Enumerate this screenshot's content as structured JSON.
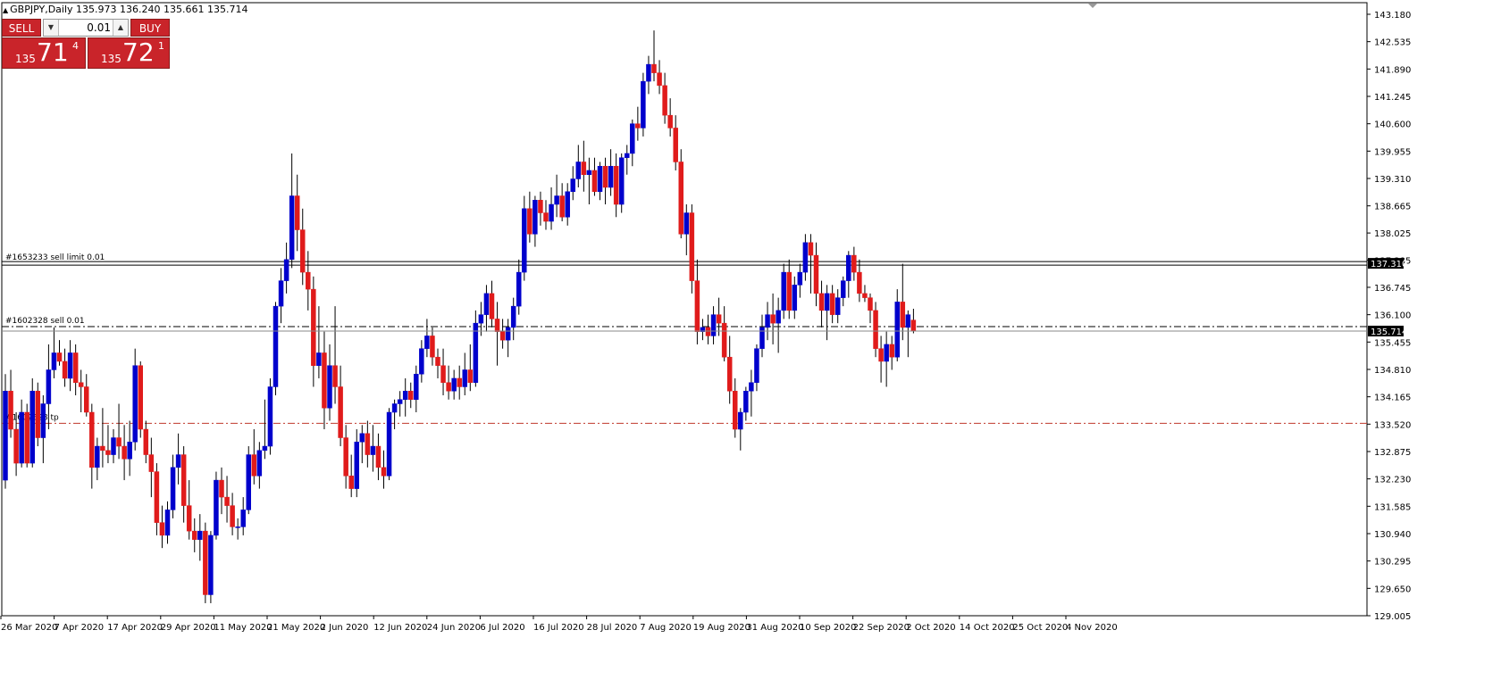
{
  "header": {
    "symbol_line": "GBPJPY,Daily  135.973 136.240 135.661 135.714"
  },
  "trade_panel": {
    "sell_label": "SELL",
    "buy_label": "BUY",
    "lot_value": "0.01",
    "sell_price_small": "135",
    "sell_price_big": "71",
    "sell_price_sup": "4",
    "buy_price_small": "135",
    "buy_price_big": "72",
    "buy_price_sup": "1"
  },
  "price_axis": {
    "labels": [
      "143.180",
      "142.535",
      "141.890",
      "141.245",
      "140.600",
      "139.955",
      "139.310",
      "138.665",
      "138.025",
      "137.385",
      "136.745",
      "136.100",
      "135.455",
      "134.810",
      "134.165",
      "133.520",
      "132.875",
      "132.230",
      "131.585",
      "130.940",
      "130.295",
      "129.650",
      "129.005"
    ],
    "current_price_tag": "135.714",
    "order_price_tag": "137.310"
  },
  "time_axis": {
    "labels": [
      "26 Mar 2020",
      "7 Apr 2020",
      "17 Apr 2020",
      "29 Apr 2020",
      "11 May 2020",
      "21 May 2020",
      "2 Jun 2020",
      "12 Jun 2020",
      "24 Jun 2020",
      "6 Jul 2020",
      "16 Jul 2020",
      "28 Jul 2020",
      "7 Aug 2020",
      "19 Aug 2020",
      "31 Aug 2020",
      "10 Sep 2020",
      "22 Sep 2020",
      "2 Oct 2020",
      "14 Oct 2020",
      "25 Oct 2020",
      "4 Nov 2020"
    ]
  },
  "order_lines": [
    {
      "label": "#1653233 sell limit 0.01",
      "price": 137.31,
      "style": "solid"
    },
    {
      "label": "#1602328 sell 0.01",
      "price": 135.82,
      "style": "dashdot"
    },
    {
      "label": "#1602328 tp",
      "price": 133.54,
      "style": "dashdot-red"
    }
  ],
  "colors": {
    "bull": "#0000cc",
    "bear": "#e01b1b",
    "wick": "#000000",
    "background": "#ffffff",
    "tp_line": "#c0392b"
  },
  "chart_data": {
    "type": "candlestick",
    "symbol": "GBPJPY",
    "timeframe": "Daily",
    "ylim": [
      129.005,
      143.18
    ],
    "candles": [
      [
        132.2,
        134.7,
        132.0,
        134.3
      ],
      [
        134.3,
        134.8,
        133.2,
        133.4
      ],
      [
        133.4,
        133.8,
        132.3,
        132.6
      ],
      [
        132.6,
        134.1,
        132.5,
        133.8
      ],
      [
        133.8,
        134.0,
        132.5,
        132.6
      ],
      [
        132.6,
        134.6,
        132.5,
        134.3
      ],
      [
        134.3,
        134.5,
        133.0,
        133.2
      ],
      [
        133.2,
        134.2,
        132.6,
        134.0
      ],
      [
        134.0,
        135.4,
        133.4,
        134.8
      ],
      [
        134.8,
        135.8,
        134.6,
        135.2
      ],
      [
        135.2,
        135.5,
        134.9,
        135.0
      ],
      [
        135.0,
        135.3,
        134.4,
        134.6
      ],
      [
        134.6,
        135.5,
        134.3,
        135.2
      ],
      [
        135.2,
        135.4,
        134.2,
        134.5
      ],
      [
        134.5,
        134.8,
        133.8,
        134.4
      ],
      [
        134.4,
        134.7,
        133.7,
        133.8
      ],
      [
        133.8,
        134.0,
        132.0,
        132.5
      ],
      [
        132.5,
        133.2,
        132.2,
        133.0
      ],
      [
        133.0,
        133.9,
        132.5,
        132.9
      ],
      [
        132.9,
        133.5,
        132.6,
        132.8
      ],
      [
        132.8,
        133.4,
        132.6,
        133.2
      ],
      [
        133.2,
        134.0,
        132.7,
        133.0
      ],
      [
        133.0,
        133.5,
        132.2,
        132.7
      ],
      [
        132.7,
        133.6,
        132.3,
        133.1
      ],
      [
        133.1,
        135.3,
        132.9,
        134.9
      ],
      [
        134.9,
        135.0,
        133.2,
        133.4
      ],
      [
        133.4,
        133.6,
        132.6,
        132.8
      ],
      [
        132.8,
        133.2,
        131.8,
        132.4
      ],
      [
        132.4,
        132.6,
        130.9,
        131.2
      ],
      [
        131.2,
        131.6,
        130.6,
        130.9
      ],
      [
        130.9,
        131.7,
        130.7,
        131.5
      ],
      [
        131.5,
        132.8,
        131.3,
        132.5
      ],
      [
        132.5,
        133.3,
        132.1,
        132.8
      ],
      [
        132.8,
        133.0,
        131.2,
        131.6
      ],
      [
        131.6,
        132.2,
        130.8,
        131.0
      ],
      [
        131.0,
        131.3,
        130.5,
        130.8
      ],
      [
        130.8,
        131.4,
        130.3,
        131.0
      ],
      [
        131.0,
        131.2,
        129.3,
        129.5
      ],
      [
        129.5,
        131.0,
        129.3,
        130.9
      ],
      [
        130.9,
        132.4,
        130.8,
        132.2
      ],
      [
        132.2,
        132.5,
        131.4,
        131.8
      ],
      [
        131.8,
        132.3,
        131.2,
        131.6
      ],
      [
        131.6,
        131.9,
        130.9,
        131.1
      ],
      [
        131.1,
        131.3,
        130.8,
        131.1
      ],
      [
        131.1,
        131.8,
        130.9,
        131.5
      ],
      [
        131.5,
        133.0,
        131.4,
        132.8
      ],
      [
        132.8,
        133.4,
        132.1,
        132.3
      ],
      [
        132.3,
        133.1,
        132.0,
        132.9
      ],
      [
        132.9,
        134.1,
        132.7,
        133.0
      ],
      [
        133.0,
        134.6,
        132.8,
        134.4
      ],
      [
        134.4,
        136.4,
        134.2,
        136.3
      ],
      [
        136.3,
        137.2,
        135.9,
        136.9
      ],
      [
        136.9,
        137.8,
        136.6,
        137.4
      ],
      [
        137.4,
        139.9,
        137.2,
        138.9
      ],
      [
        138.9,
        139.4,
        137.6,
        138.1
      ],
      [
        138.1,
        138.6,
        136.8,
        137.1
      ],
      [
        137.1,
        137.6,
        136.2,
        136.7
      ],
      [
        136.7,
        137.0,
        134.4,
        134.9
      ],
      [
        134.9,
        136.3,
        134.6,
        135.2
      ],
      [
        135.2,
        135.7,
        133.4,
        133.9
      ],
      [
        133.9,
        135.4,
        133.6,
        134.9
      ],
      [
        134.9,
        136.3,
        134.0,
        134.4
      ],
      [
        134.4,
        134.9,
        133.0,
        133.2
      ],
      [
        133.2,
        133.5,
        132.0,
        132.3
      ],
      [
        132.3,
        132.8,
        131.8,
        132.0
      ],
      [
        132.0,
        133.4,
        131.8,
        133.1
      ],
      [
        133.1,
        133.5,
        132.6,
        133.3
      ],
      [
        133.3,
        133.6,
        132.5,
        132.8
      ],
      [
        132.8,
        133.5,
        132.4,
        133.0
      ],
      [
        133.0,
        133.3,
        132.2,
        132.5
      ],
      [
        132.5,
        132.9,
        132.0,
        132.3
      ],
      [
        132.3,
        133.9,
        132.2,
        133.8
      ],
      [
        133.8,
        134.1,
        133.4,
        134.0
      ],
      [
        134.0,
        134.3,
        133.7,
        134.1
      ],
      [
        134.1,
        134.6,
        133.7,
        134.3
      ],
      [
        134.3,
        134.5,
        133.9,
        134.1
      ],
      [
        134.1,
        134.9,
        133.8,
        134.7
      ],
      [
        134.7,
        135.5,
        134.5,
        135.3
      ],
      [
        135.3,
        136.0,
        135.1,
        135.6
      ],
      [
        135.6,
        135.8,
        134.9,
        135.1
      ],
      [
        135.1,
        135.3,
        134.6,
        134.9
      ],
      [
        134.9,
        135.3,
        134.2,
        134.5
      ],
      [
        134.5,
        134.9,
        134.1,
        134.3
      ],
      [
        134.3,
        134.8,
        134.1,
        134.6
      ],
      [
        134.6,
        134.9,
        134.1,
        134.4
      ],
      [
        134.4,
        135.2,
        134.2,
        134.8
      ],
      [
        134.8,
        135.4,
        134.3,
        134.5
      ],
      [
        134.5,
        136.2,
        134.4,
        135.9
      ],
      [
        135.9,
        136.4,
        135.6,
        136.1
      ],
      [
        136.1,
        136.8,
        135.7,
        136.6
      ],
      [
        136.6,
        136.9,
        135.8,
        136.0
      ],
      [
        136.0,
        136.4,
        134.9,
        135.7
      ],
      [
        135.7,
        136.0,
        135.3,
        135.5
      ],
      [
        135.5,
        136.0,
        135.1,
        135.8
      ],
      [
        135.8,
        136.5,
        135.5,
        136.3
      ],
      [
        136.3,
        137.4,
        136.1,
        137.1
      ],
      [
        137.1,
        138.9,
        136.9,
        138.6
      ],
      [
        138.6,
        139.0,
        137.8,
        138.0
      ],
      [
        138.0,
        138.9,
        137.7,
        138.8
      ],
      [
        138.8,
        139.0,
        138.2,
        138.5
      ],
      [
        138.5,
        138.8,
        138.1,
        138.3
      ],
      [
        138.3,
        139.1,
        138.1,
        138.7
      ],
      [
        138.7,
        139.4,
        138.4,
        138.9
      ],
      [
        138.9,
        139.2,
        138.3,
        138.4
      ],
      [
        138.4,
        139.2,
        138.2,
        139.0
      ],
      [
        139.0,
        139.6,
        138.8,
        139.3
      ],
      [
        139.3,
        140.1,
        139.1,
        139.7
      ],
      [
        139.7,
        140.2,
        139.0,
        139.4
      ],
      [
        139.4,
        139.8,
        138.7,
        139.5
      ],
      [
        139.5,
        139.8,
        138.9,
        139.0
      ],
      [
        139.0,
        139.7,
        138.8,
        139.6
      ],
      [
        139.6,
        139.8,
        138.7,
        139.1
      ],
      [
        139.1,
        140.0,
        138.9,
        139.6
      ],
      [
        139.6,
        139.9,
        138.4,
        138.7
      ],
      [
        138.7,
        139.9,
        138.5,
        139.8
      ],
      [
        139.8,
        140.1,
        139.4,
        139.9
      ],
      [
        139.9,
        140.7,
        139.6,
        140.6
      ],
      [
        140.6,
        141.0,
        140.2,
        140.5
      ],
      [
        140.5,
        141.8,
        140.3,
        141.6
      ],
      [
        141.6,
        142.2,
        141.3,
        142.0
      ],
      [
        142.0,
        142.8,
        141.6,
        141.8
      ],
      [
        141.8,
        142.1,
        141.3,
        141.5
      ],
      [
        141.5,
        141.8,
        140.6,
        140.8
      ],
      [
        140.8,
        141.2,
        140.3,
        140.5
      ],
      [
        140.5,
        140.8,
        139.5,
        139.7
      ],
      [
        139.7,
        140.0,
        137.9,
        138.0
      ],
      [
        138.0,
        138.7,
        137.5,
        138.5
      ],
      [
        138.5,
        138.7,
        136.6,
        136.9
      ],
      [
        136.9,
        137.4,
        135.4,
        135.7
      ],
      [
        135.7,
        136.0,
        135.5,
        135.8
      ],
      [
        135.8,
        136.1,
        135.4,
        135.6
      ],
      [
        135.6,
        136.3,
        135.4,
        136.1
      ],
      [
        136.1,
        136.5,
        135.6,
        135.9
      ],
      [
        135.9,
        136.3,
        135.0,
        135.1
      ],
      [
        135.1,
        135.6,
        134.0,
        134.3
      ],
      [
        134.3,
        134.6,
        133.2,
        133.4
      ],
      [
        133.4,
        133.9,
        132.9,
        133.8
      ],
      [
        133.8,
        134.4,
        133.6,
        134.3
      ],
      [
        134.3,
        134.8,
        133.7,
        134.5
      ],
      [
        134.5,
        135.4,
        134.3,
        135.3
      ],
      [
        135.3,
        136.1,
        135.1,
        135.8
      ],
      [
        135.8,
        136.4,
        135.5,
        136.1
      ],
      [
        136.1,
        136.6,
        135.4,
        135.9
      ],
      [
        135.9,
        136.5,
        135.2,
        136.2
      ],
      [
        136.2,
        137.3,
        136.0,
        137.1
      ],
      [
        137.1,
        137.4,
        136.0,
        136.2
      ],
      [
        136.2,
        137.0,
        136.0,
        136.8
      ],
      [
        136.8,
        137.3,
        136.5,
        137.1
      ],
      [
        137.1,
        138.0,
        136.9,
        137.8
      ],
      [
        137.8,
        138.0,
        136.6,
        137.5
      ],
      [
        137.5,
        137.8,
        136.3,
        136.6
      ],
      [
        136.6,
        136.9,
        135.8,
        136.2
      ],
      [
        136.2,
        136.8,
        135.5,
        136.6
      ],
      [
        136.6,
        136.8,
        135.9,
        136.1
      ],
      [
        136.1,
        136.7,
        135.9,
        136.5
      ],
      [
        136.5,
        137.0,
        136.3,
        136.9
      ],
      [
        136.9,
        137.6,
        136.5,
        137.5
      ],
      [
        137.5,
        137.7,
        136.9,
        137.1
      ],
      [
        137.1,
        137.4,
        136.4,
        136.6
      ],
      [
        136.6,
        136.8,
        136.4,
        136.5
      ],
      [
        136.5,
        136.6,
        135.9,
        136.2
      ],
      [
        136.2,
        136.4,
        135.1,
        135.3
      ],
      [
        135.3,
        135.6,
        134.5,
        135.0
      ],
      [
        135.0,
        135.7,
        134.4,
        135.4
      ],
      [
        135.4,
        135.6,
        134.8,
        135.1
      ],
      [
        135.1,
        136.7,
        135.0,
        136.4
      ],
      [
        136.4,
        137.3,
        135.5,
        135.8
      ],
      [
        135.8,
        136.2,
        135.1,
        136.1
      ],
      [
        135.973,
        136.24,
        135.661,
        135.714
      ]
    ]
  }
}
